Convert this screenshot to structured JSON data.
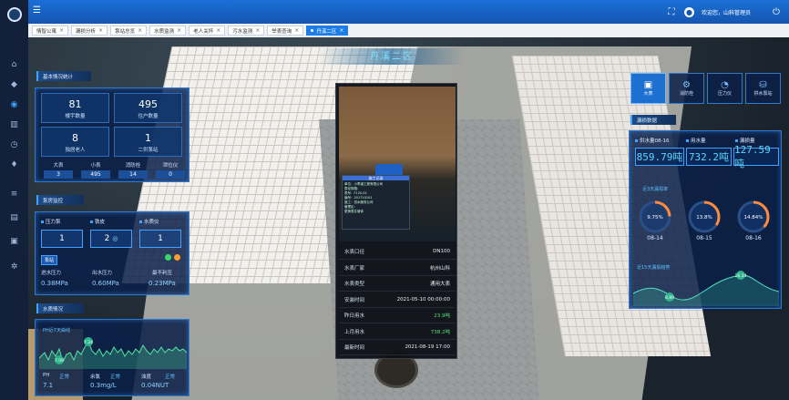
{
  "header": {
    "welcome": "欢迎您，山科管理员"
  },
  "tabs": [
    {
      "label": "情智公寓",
      "active": false
    },
    {
      "label": "漏损分析",
      "active": false
    },
    {
      "label": "泵站总览",
      "active": false
    },
    {
      "label": "水质监测",
      "active": false
    },
    {
      "label": "老人关怀",
      "active": false
    },
    {
      "label": "污水监测",
      "active": false
    },
    {
      "label": "举表查询",
      "active": false
    },
    {
      "label": "丹溪二区",
      "active": true
    }
  ],
  "region_title": "丹溪二区",
  "basic": {
    "title": "基本情况统计",
    "stats": [
      {
        "value": "81",
        "label": "楼宇数量"
      },
      {
        "value": "495",
        "label": "住户数量"
      },
      {
        "value": "8",
        "label": "独居老人"
      },
      {
        "value": "1",
        "label": "二供泵站"
      }
    ],
    "minis": [
      {
        "label": "大表",
        "value": "3"
      },
      {
        "label": "小表",
        "value": "495"
      },
      {
        "label": "消防栓",
        "value": "14"
      },
      {
        "label": "泄位仪",
        "value": "0"
      }
    ]
  },
  "pump": {
    "title": "泵房监控",
    "items": [
      {
        "label": "压力泵",
        "value": "1"
      },
      {
        "label": "铁皮",
        "value": "2"
      },
      {
        "label": "水质仪",
        "value": "1"
      }
    ],
    "tag": "泵站",
    "readings": [
      {
        "label": "进水压力",
        "value": "0.38MPa"
      },
      {
        "label": "出水压力",
        "value": "0.60MPa"
      },
      {
        "label": "最不利压",
        "value": "0.23MPa"
      }
    ]
  },
  "water_quality": {
    "title": "水质情况",
    "chart_label": "PH近7天曲线",
    "peak_labels": [
      "7.24",
      "7.09"
    ],
    "readings": [
      {
        "label": "PH",
        "status": "正常",
        "value": "7.1"
      },
      {
        "label": "余氯",
        "status": "正常",
        "value": "0.3mg/L"
      },
      {
        "label": "浊度",
        "status": "正常",
        "value": "0.04NUT"
      }
    ]
  },
  "popup": {
    "board_title": "施工记录",
    "board_lines": [
      "单位：小乖道工程有限公司",
      "表径规格：",
      "表号：F120,02",
      "编号：201710101",
      "施工：供水服务公司",
      "管理区：",
      "更换表井管体"
    ],
    "rows": [
      {
        "label": "水表口径",
        "value": "DN100",
        "green": false
      },
      {
        "label": "水表厂家",
        "value": "杭州山科",
        "green": false
      },
      {
        "label": "水表类型",
        "value": "通用大表",
        "green": false
      },
      {
        "label": "安装时间",
        "value": "2021-05-10 00:00:00",
        "green": false
      },
      {
        "label": "昨日用水",
        "value": "23.9吨",
        "green": true
      },
      {
        "label": "上月用水",
        "value": "738.2吨",
        "green": true
      },
      {
        "label": "最新时间",
        "value": "2021-08-19 17:00",
        "green": false
      }
    ]
  },
  "right": {
    "icons": [
      {
        "label": "大表",
        "icon": "meter-icon",
        "active": true
      },
      {
        "label": "消防栓",
        "icon": "hydrant-icon",
        "active": false
      },
      {
        "label": "压力仪",
        "icon": "gauge-icon",
        "active": false
      },
      {
        "label": "供水泵站",
        "icon": "pump-icon",
        "active": false
      }
    ],
    "panel_title": "漏损数据",
    "meters": [
      {
        "label": "供水量08-16",
        "value": "859.79吨"
      },
      {
        "label": "用水量",
        "value": "732.2吨"
      },
      {
        "label": "漏损量",
        "value": "127.59吨"
      }
    ],
    "rings_title": "近3天漏损率",
    "rings": [
      {
        "percent": 9.75,
        "label": "9.75%",
        "date": "08-14"
      },
      {
        "percent": 13.8,
        "label": "13.8%",
        "date": "08-15"
      },
      {
        "percent": 14.84,
        "label": "14.84%",
        "date": "08-16"
      }
    ],
    "trend_title": "近15天漏损趋势",
    "trend_labels": [
      "16.34",
      "8.89"
    ]
  },
  "colors": {
    "accent": "#3fa2ff",
    "ring": "#ff8a3d",
    "header": "#1b6fd6"
  }
}
